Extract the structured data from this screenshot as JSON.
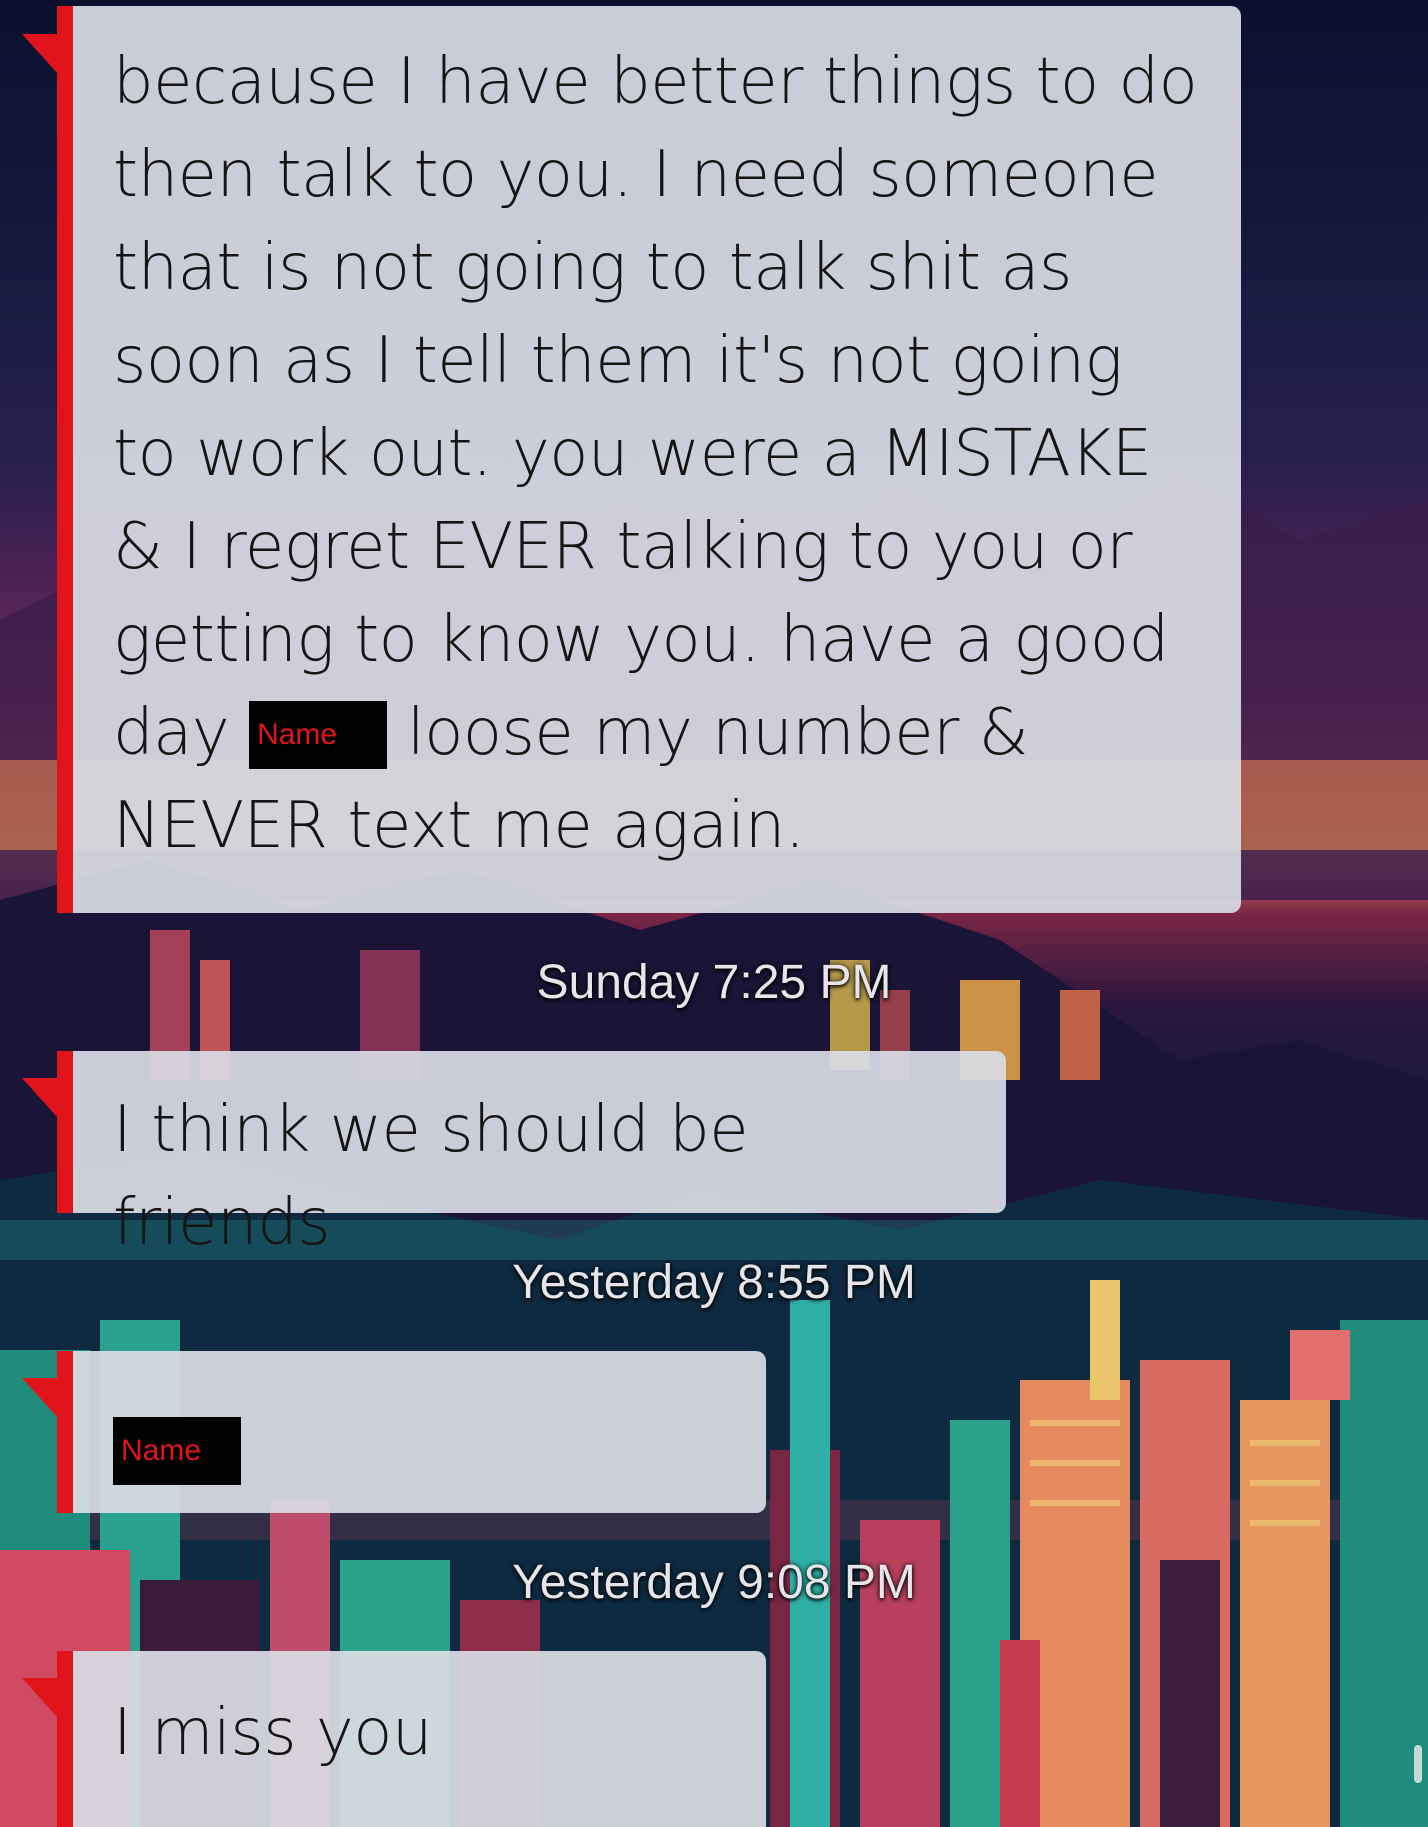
{
  "colors": {
    "accent": "#e0141a",
    "bubble_bg": "#d8dbe4",
    "redaction_bg": "#000000",
    "redaction_text": "#e3151c",
    "timestamp_text": "#e6e6ea"
  },
  "messages": [
    {
      "text_before": "because I have better things to do then talk to you. I need someone that is not going to talk shit as soon as I tell them it's not going to work out. you were a MISTAKE & I regret EVER talking to you or getting to know you. have a good day",
      "redaction": "Name",
      "text_after": "loose my number & NEVER text me again."
    },
    {
      "timestamp": "Sunday 7:25 PM",
      "text": "I think we should be friends"
    },
    {
      "timestamp": "Yesterday 8:55 PM",
      "redaction": "Name"
    },
    {
      "timestamp": "Yesterday 9:08 PM",
      "text": "I miss you"
    }
  ]
}
